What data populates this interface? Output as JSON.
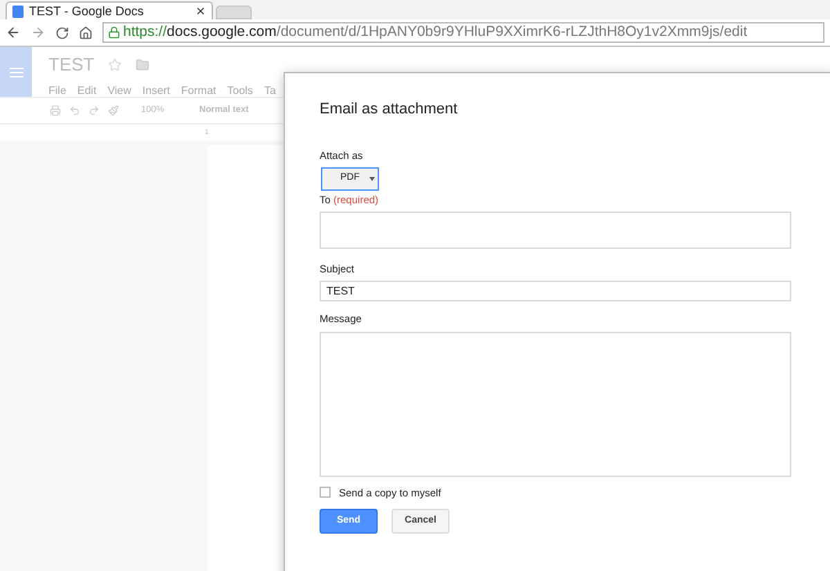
{
  "browser": {
    "tab": {
      "title": "TEST - Google Docs"
    },
    "url": {
      "scheme": "https://",
      "domain": "docs.google.com",
      "path": "/document/d/1HpANY0b9r9YHluP9XXimrK6-rLZJthH8Oy1v2Xmm9js/edit"
    }
  },
  "doc": {
    "title": "TEST",
    "menu": [
      "File",
      "Edit",
      "View",
      "Insert",
      "Format",
      "Tools",
      "Ta"
    ],
    "zoom": "100%",
    "style": "Normal text",
    "ruler": "1"
  },
  "dialog": {
    "title": "Email as attachment",
    "attach_label": "Attach as",
    "attach_value": "PDF",
    "to_label": "To",
    "to_required": "(required)",
    "subject_label": "Subject",
    "subject_value": "TEST",
    "message_label": "Message",
    "copy": {
      "label": "Send a copy to myself",
      "checked": false
    },
    "buttons": [
      {
        "label": "Send",
        "kind": "primary"
      },
      {
        "label": "Cancel",
        "kind": "secondary"
      }
    ]
  }
}
